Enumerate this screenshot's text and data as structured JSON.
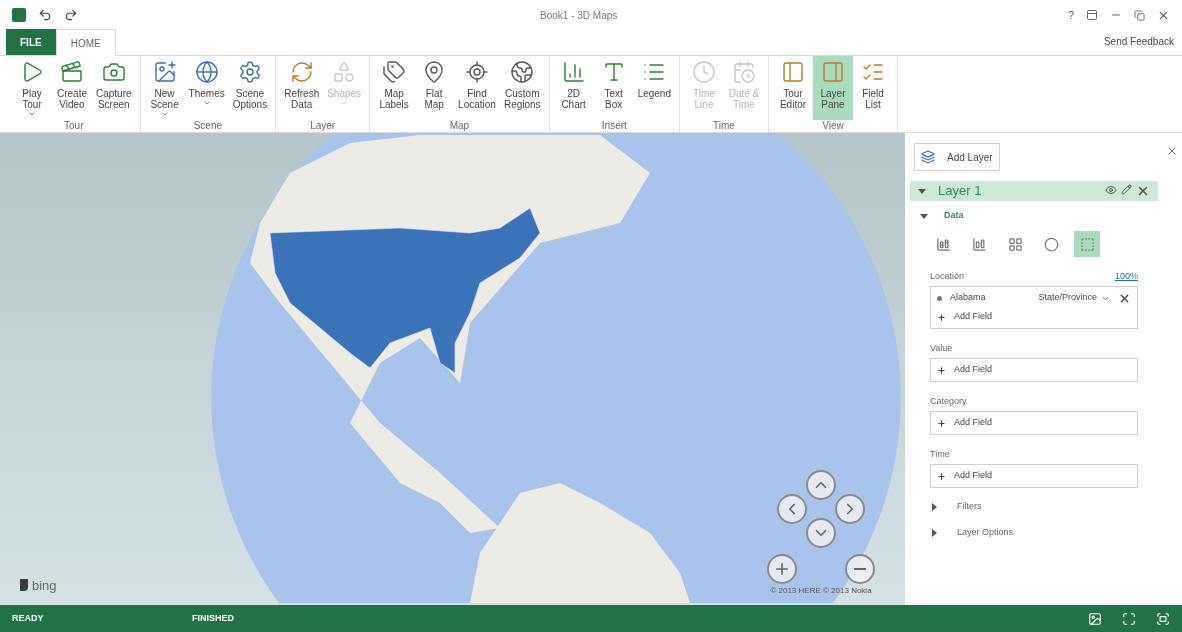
{
  "window": {
    "title": "Book1 - 3D Maps",
    "help": "?"
  },
  "ribbon": {
    "tabs": [
      {
        "label": "FILE",
        "kind": "file",
        "selected": false
      },
      {
        "label": "HOME",
        "kind": "tab",
        "selected": true
      }
    ],
    "send_feedback": "Send Feedback",
    "groups": [
      {
        "label": "Tour",
        "buttons": [
          {
            "lines": [
              "Play",
              "Tour"
            ],
            "dropdown": true,
            "disabled": false,
            "selected": false
          },
          {
            "lines": [
              "Create",
              "Video"
            ],
            "dropdown": false,
            "disabled": false,
            "selected": false
          },
          {
            "lines": [
              "Capture",
              "Screen"
            ],
            "dropdown": false,
            "disabled": false,
            "selected": false
          }
        ]
      },
      {
        "label": "Scene",
        "buttons": [
          {
            "lines": [
              "New",
              "Scene"
            ],
            "dropdown": true,
            "disabled": false,
            "selected": false
          },
          {
            "lines": [
              "Themes"
            ],
            "dropdown": true,
            "disabled": false,
            "selected": false
          },
          {
            "lines": [
              "Scene",
              "Options"
            ],
            "dropdown": false,
            "disabled": false,
            "selected": false
          }
        ]
      },
      {
        "label": "Layer",
        "buttons": [
          {
            "lines": [
              "Refresh",
              "Data"
            ],
            "dropdown": false,
            "disabled": false,
            "selected": false
          },
          {
            "lines": [
              "Shapes"
            ],
            "dropdown": true,
            "disabled": true,
            "selected": false
          }
        ]
      },
      {
        "label": "Map",
        "buttons": [
          {
            "lines": [
              "Map",
              "Labels"
            ],
            "dropdown": false,
            "disabled": false,
            "selected": false
          },
          {
            "lines": [
              "Flat",
              "Map"
            ],
            "dropdown": false,
            "disabled": false,
            "selected": false
          },
          {
            "lines": [
              "Find",
              "Location"
            ],
            "dropdown": false,
            "disabled": false,
            "selected": false
          },
          {
            "lines": [
              "Custom",
              "Regions"
            ],
            "dropdown": false,
            "disabled": false,
            "selected": false
          }
        ]
      },
      {
        "label": "Insert",
        "buttons": [
          {
            "lines": [
              "2D",
              "Chart"
            ],
            "dropdown": false,
            "disabled": false,
            "selected": false
          },
          {
            "lines": [
              "Text",
              "Box"
            ],
            "dropdown": false,
            "disabled": false,
            "selected": false
          },
          {
            "lines": [
              "Legend"
            ],
            "dropdown": false,
            "disabled": false,
            "selected": false
          }
        ]
      },
      {
        "label": "Time",
        "buttons": [
          {
            "lines": [
              "Time",
              "Line"
            ],
            "dropdown": false,
            "disabled": true,
            "selected": false
          },
          {
            "lines": [
              "Date &",
              "Time"
            ],
            "dropdown": false,
            "disabled": true,
            "selected": false
          }
        ]
      },
      {
        "label": "View",
        "buttons": [
          {
            "lines": [
              "Tour",
              "Editor"
            ],
            "dropdown": false,
            "disabled": false,
            "selected": false
          },
          {
            "lines": [
              "Layer",
              "Pane"
            ],
            "dropdown": false,
            "disabled": false,
            "selected": true
          },
          {
            "lines": [
              "Field",
              "List"
            ],
            "dropdown": false,
            "disabled": false,
            "selected": false
          }
        ]
      }
    ]
  },
  "map": {
    "logo": "bing",
    "attribution": "© 2013 HERE © 2013 Nokia"
  },
  "panel": {
    "add_layer": "Add Layer",
    "layer": {
      "name": "Layer 1",
      "expanded": true
    },
    "data": {
      "label": "Data",
      "expanded": true
    },
    "layer_types": [
      {
        "selected": false
      },
      {
        "selected": false
      },
      {
        "selected": false
      },
      {
        "selected": false
      },
      {
        "selected": true
      }
    ],
    "wells": [
      {
        "label": "Location",
        "link": "100%",
        "fields": [
          {
            "name": "Alabama",
            "type": "State/Province"
          }
        ],
        "add": "Add Field"
      },
      {
        "label": "Value",
        "add": "Add Field"
      },
      {
        "label": "Category",
        "add": "Add Field"
      },
      {
        "label": "Time",
        "add": "Add Field"
      }
    ],
    "sections": [
      {
        "label": "Filters",
        "expanded": false
      },
      {
        "label": "Layer Options",
        "expanded": false
      }
    ]
  },
  "status_bar": {
    "left": "READY",
    "middle": "FINISHED"
  }
}
